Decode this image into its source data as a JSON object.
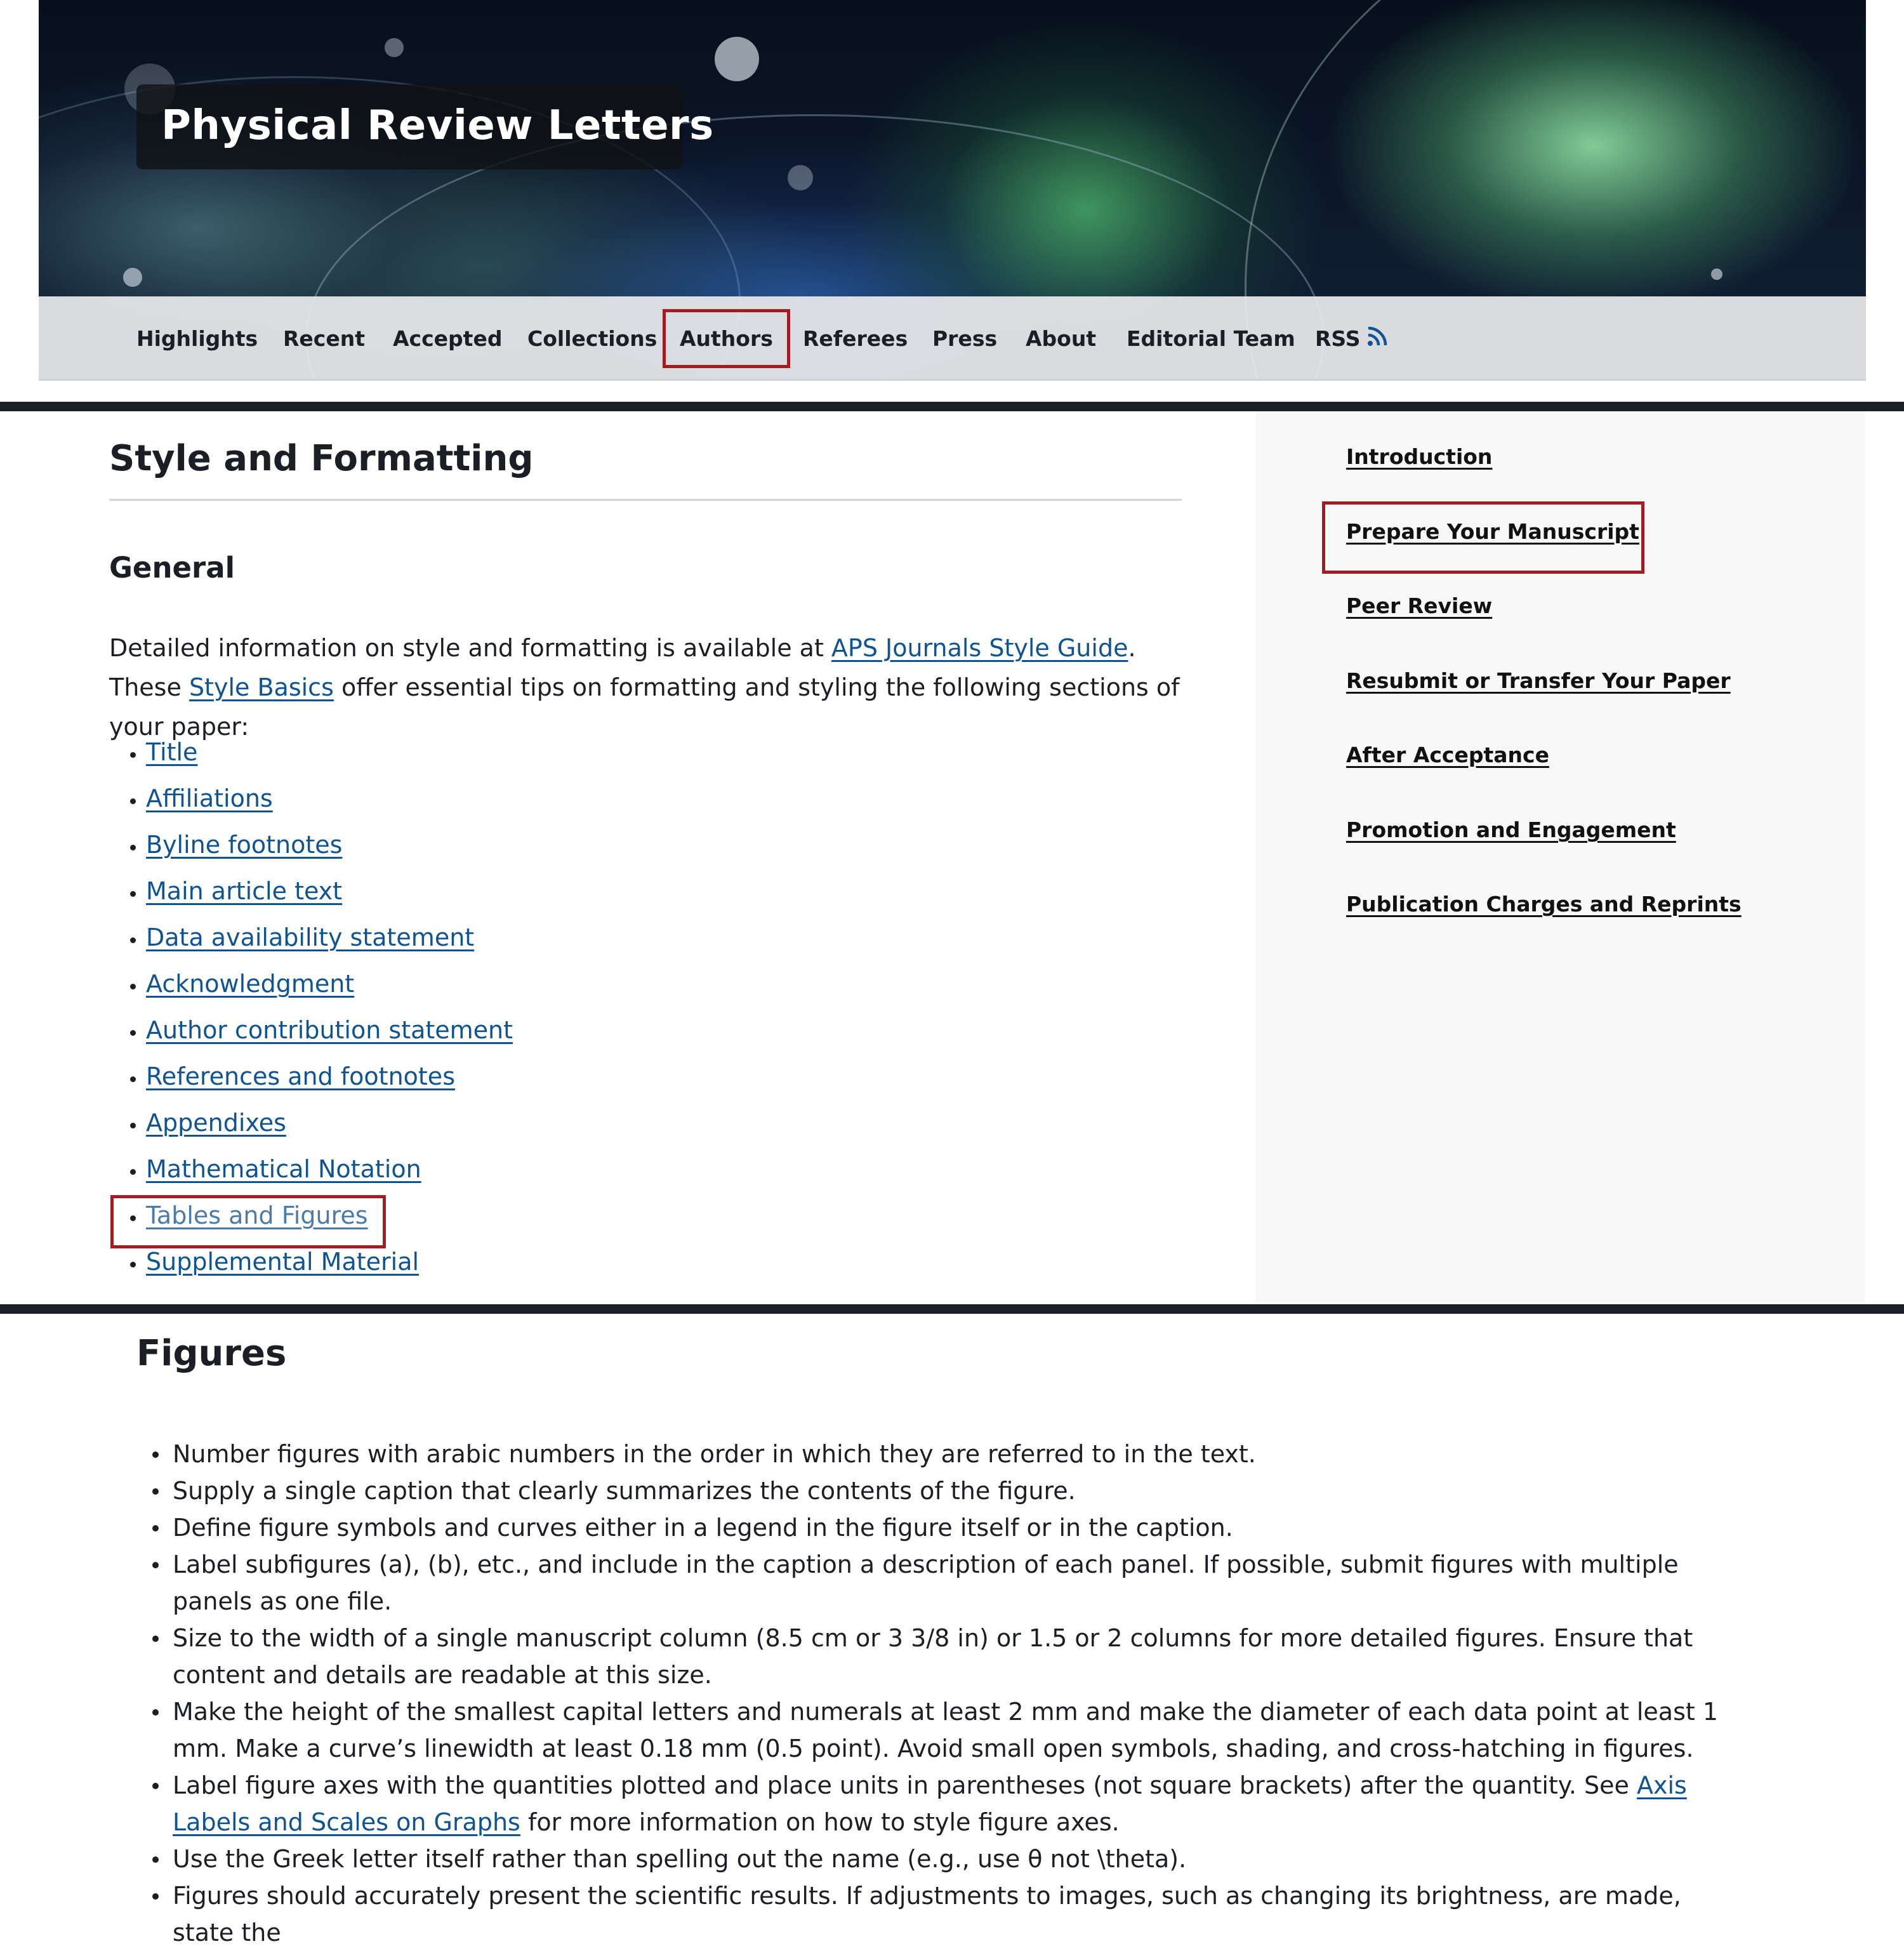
{
  "header": {
    "journal_title": "Physical Review Letters",
    "nav": [
      {
        "label": "Highlights"
      },
      {
        "label": "Recent"
      },
      {
        "label": "Accepted"
      },
      {
        "label": "Collections"
      },
      {
        "label": "Authors",
        "highlighted": true
      },
      {
        "label": "Referees"
      },
      {
        "label": "Press"
      },
      {
        "label": "About"
      },
      {
        "label": "Editorial Team"
      },
      {
        "label": "RSS",
        "icon": "rss-icon"
      }
    ],
    "rss_color": "#0f5391",
    "highlight_color": "#a11d21"
  },
  "main": {
    "page_title": "Style and Formatting",
    "section_title": "General",
    "intro": {
      "text_before": "Detailed information on style and formatting is available at ",
      "link1": "APS Journals Style Guide",
      "text_middle": ". These ",
      "link2": "Style Basics",
      "text_after": " offer essential tips on formatting and styling the following sections of your paper:"
    },
    "sections": [
      {
        "label": "Title"
      },
      {
        "label": "Affiliations"
      },
      {
        "label": "Byline footnotes"
      },
      {
        "label": "Main article text"
      },
      {
        "label": "Data availability statement"
      },
      {
        "label": "Acknowledgment"
      },
      {
        "label": "Author contribution statement"
      },
      {
        "label": "References and footnotes"
      },
      {
        "label": "Appendixes"
      },
      {
        "label": "Mathematical Notation"
      },
      {
        "label": "Tables and Figures",
        "highlighted": true
      },
      {
        "label": "Supplemental Material"
      }
    ]
  },
  "sidebar": {
    "items": [
      {
        "label": "Introduction"
      },
      {
        "label": "Prepare Your Manuscript",
        "highlighted": true
      },
      {
        "label": "Peer Review"
      },
      {
        "label": "Resubmit or Transfer Your Paper"
      },
      {
        "label": "After Acceptance"
      },
      {
        "label": "Promotion and Engagement"
      },
      {
        "label": "Publication Charges and Reprints"
      }
    ]
  },
  "figures": {
    "title": "Figures",
    "items": [
      {
        "text": "Number figures with arabic numbers in the order in which they are referred to in the text."
      },
      {
        "text": "Supply a single caption that clearly summarizes the contents of the figure."
      },
      {
        "text": "Define figure symbols and curves either in a legend in the figure itself or in the caption."
      },
      {
        "text": "Label subfigures (a), (b), etc., and include in the caption a description of each panel. If possible, submit figures with multiple panels as one file."
      },
      {
        "text": "Size to the width of a single manuscript column (8.5 cm or 3 3/8 in) or 1.5 or 2 columns for more detailed figures. Ensure that content and details are readable at this size."
      },
      {
        "text": "Make the height of the smallest capital letters and numerals at least 2 mm and make the diameter of each data point at least 1 mm. Make a curve’s linewidth at least 0.18 mm (0.5 point). Avoid small open symbols, shading, and cross-hatching in figures."
      },
      {
        "text_before": "Label figure axes with the quantities plotted and place units in parentheses (not square brackets) after the quantity. See ",
        "link": "Axis Labels and Scales on Graphs",
        "text_after": " for more information on how to style figure axes."
      },
      {
        "text": "Use the Greek letter itself rather than spelling out the name (e.g., use θ not \\theta)."
      },
      {
        "text": "Figures should accurately present the scientific results. If adjustments to images, such as changing its brightness, are made, state the"
      }
    ]
  }
}
